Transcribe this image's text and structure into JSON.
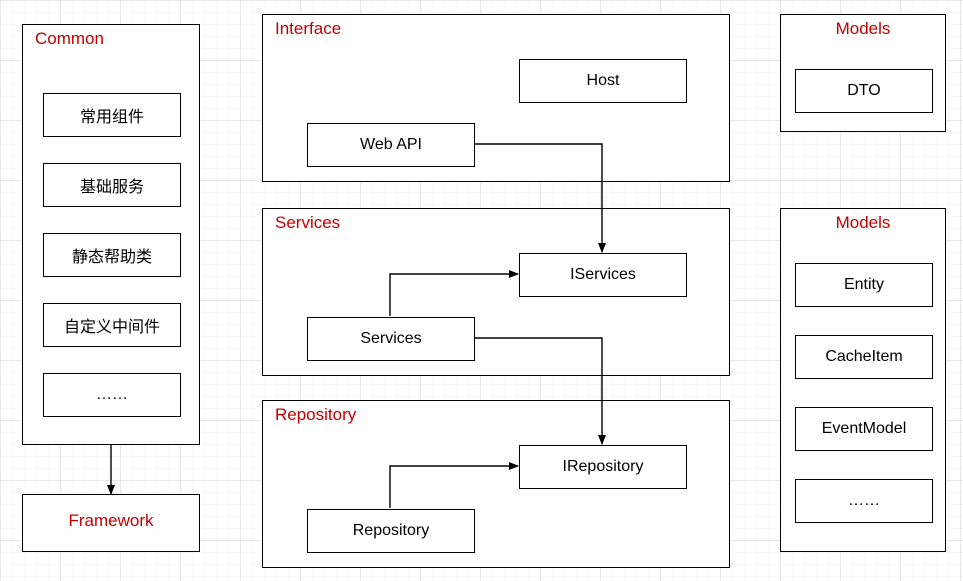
{
  "chart_data": {
    "type": "diagram",
    "title": "",
    "groups": [
      {
        "id": "common",
        "title": "Common",
        "items": [
          "常用组件",
          "基础服务",
          "静态帮助类",
          "自定义中间件",
          "……"
        ]
      },
      {
        "id": "framework",
        "title": "Framework",
        "items": []
      },
      {
        "id": "interface",
        "title": "Interface",
        "items": [
          "Web API",
          "Host"
        ]
      },
      {
        "id": "services",
        "title": "Services",
        "items": [
          "Services",
          "IServices"
        ]
      },
      {
        "id": "repository",
        "title": "Repository",
        "items": [
          "Repository",
          "IRepository"
        ]
      },
      {
        "id": "models_top",
        "title": "Models",
        "items": [
          "DTO"
        ]
      },
      {
        "id": "models_bottom",
        "title": "Models",
        "items": [
          "Entity",
          "CacheItem",
          "EventModel",
          "……"
        ]
      }
    ],
    "arrows": [
      {
        "from": "Common",
        "to": "Framework"
      },
      {
        "from": "Web API",
        "to": "IServices"
      },
      {
        "from": "Services",
        "to": "IServices"
      },
      {
        "from": "Services",
        "to": "IRepository"
      },
      {
        "from": "Repository",
        "to": "IRepository"
      }
    ]
  },
  "common": {
    "title": "Common",
    "it0": "常用组件",
    "it1": "基础服务",
    "it2": "静态帮助类",
    "it3": "自定义中间件",
    "it4": "……"
  },
  "framework": {
    "title": "Framework"
  },
  "interface": {
    "title": "Interface",
    "webapi": "Web API",
    "host": "Host"
  },
  "services": {
    "title": "Services",
    "svc": "Services",
    "isvc": "IServices"
  },
  "repository": {
    "title": "Repository",
    "repo": "Repository",
    "irepo": "IRepository"
  },
  "models_top": {
    "title": "Models",
    "dto": "DTO"
  },
  "models_bottom": {
    "title": "Models",
    "it0": "Entity",
    "it1": "CacheItem",
    "it2": "EventModel",
    "it3": "……"
  }
}
